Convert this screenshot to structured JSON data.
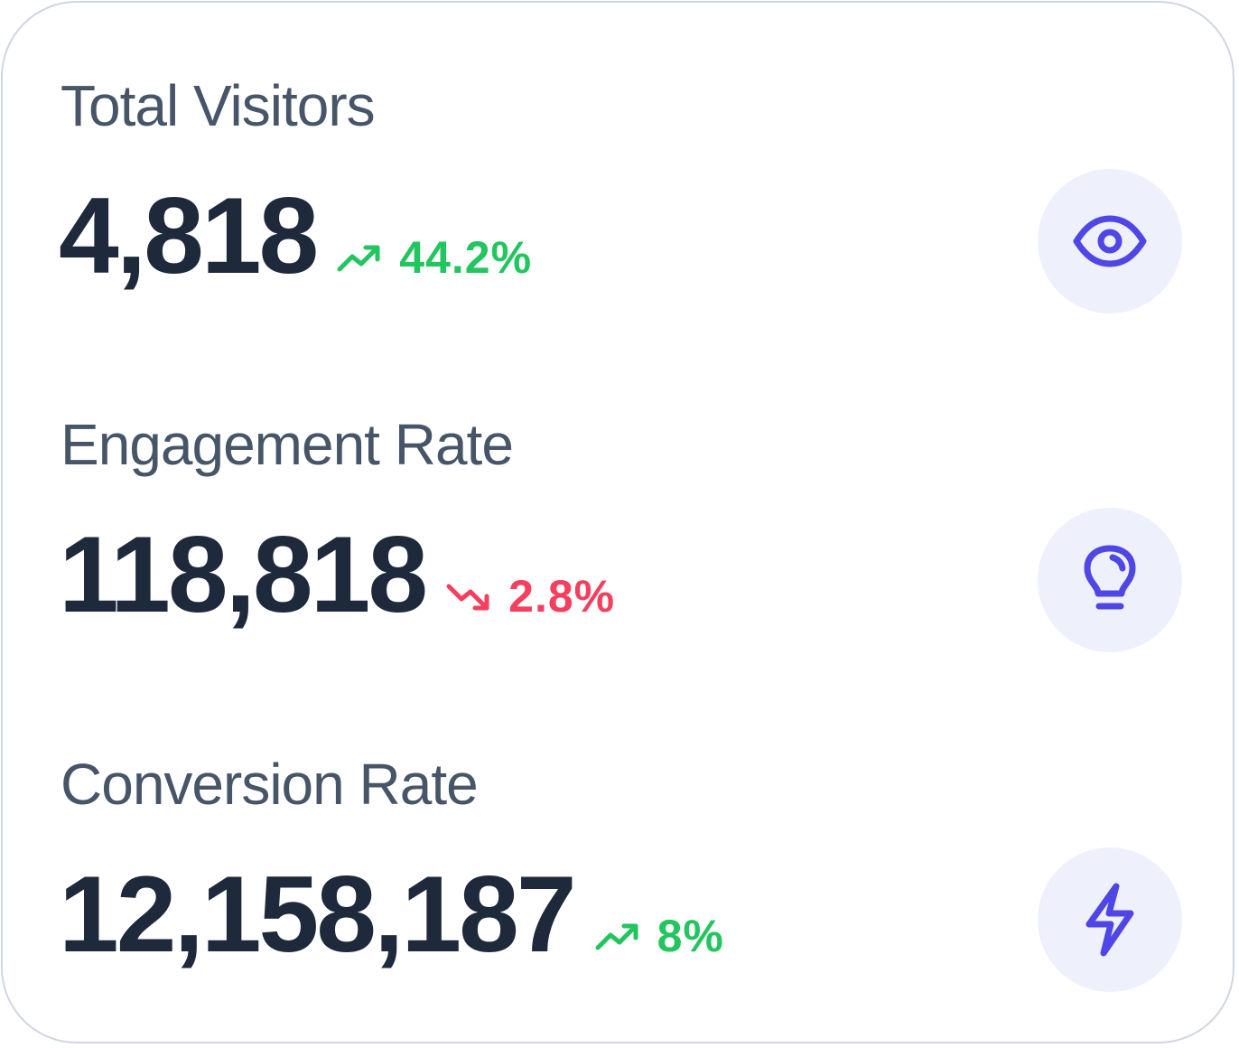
{
  "metrics": [
    {
      "label": "Total Visitors",
      "value": "4,818",
      "change": "44.2%",
      "direction": "up",
      "icon": "eye-icon"
    },
    {
      "label": "Engagement Rate",
      "value": "118,818",
      "change": "2.8%",
      "direction": "down",
      "icon": "lightbulb-icon"
    },
    {
      "label": "Conversion Rate",
      "value": "12,158,187",
      "change": "8%",
      "direction": "up",
      "icon": "lightning-bolt-icon"
    }
  ],
  "colors": {
    "label": "#475569",
    "value": "#1e293b",
    "up": "#22c55e",
    "down": "#f43f5e",
    "icon_accent": "#4f46e5",
    "icon_background": "#eef1fc",
    "card_border": "#cfd6e2"
  }
}
